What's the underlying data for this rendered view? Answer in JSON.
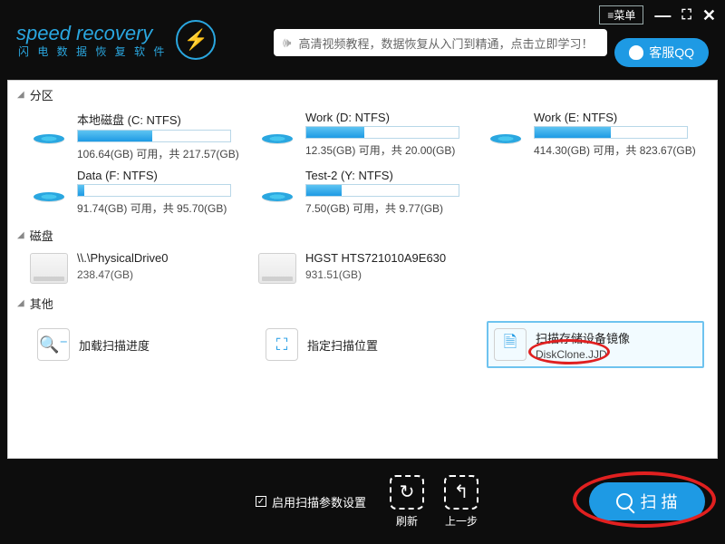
{
  "window": {
    "menu_label": "≡菜单",
    "minimize": "—",
    "maximize": "⛶",
    "close": "✕"
  },
  "brand": {
    "title": "speed recovery",
    "subtitle": "闪 电 数 据 恢 复 软 件",
    "badge_glyph": "⚡"
  },
  "tutorial": {
    "speaker_glyph": "🕪",
    "text": "高清视频教程，数据恢复从入门到精通，点击立即学习！"
  },
  "qq_button": {
    "label": "客服QQ"
  },
  "sections": {
    "partitions_title": "分区",
    "disks_title": "磁盘",
    "other_title": "其他"
  },
  "partitions": [
    {
      "name": "本地磁盘 (C: NTFS)",
      "used_pct": 49,
      "desc": "106.64(GB) 可用，共 217.57(GB)"
    },
    {
      "name": "Work (D: NTFS)",
      "used_pct": 38,
      "desc": "12.35(GB) 可用，共 20.00(GB)"
    },
    {
      "name": "Work (E: NTFS)",
      "used_pct": 50,
      "desc": "414.30(GB) 可用，共 823.67(GB)"
    },
    {
      "name": "Data (F: NTFS)",
      "used_pct": 4,
      "desc": "91.74(GB) 可用，共 95.70(GB)"
    },
    {
      "name": "Test-2 (Y: NTFS)",
      "used_pct": 23,
      "desc": "7.50(GB) 可用，共 9.77(GB)"
    }
  ],
  "disks": [
    {
      "name": "\\\\.\\PhysicalDrive0",
      "desc": "238.47(GB)"
    },
    {
      "name": "HGST HTS721010A9E630",
      "desc": "931.51(GB)"
    }
  ],
  "other": [
    {
      "icon": "search",
      "label": "加载扫描进度",
      "sub": ""
    },
    {
      "icon": "locate",
      "label": "指定扫描位置",
      "sub": ""
    },
    {
      "icon": "image",
      "label": "扫描存储设备镜像",
      "sub": "DiskClone.JJD",
      "selected": true
    }
  ],
  "footer": {
    "checkbox_label": "启用扫描参数设置",
    "checkbox_checked": true,
    "refresh_label": "刷新",
    "refresh_glyph": "↻",
    "back_label": "上一步",
    "back_glyph": "↰",
    "scan_label": "扫 描"
  },
  "annotations": {
    "ellipse_on_sub": true,
    "ellipse_on_scan": true
  }
}
